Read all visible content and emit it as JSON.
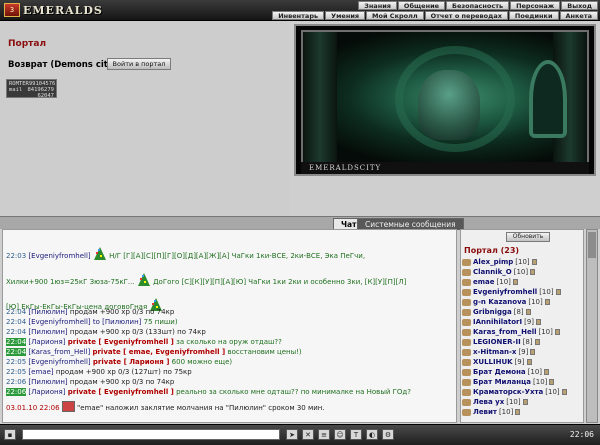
{
  "app": {
    "logo_mark": "3",
    "logo_name": "EMERALDS"
  },
  "menu": {
    "row1": [
      "Знания",
      "Общение",
      "Безопасность",
      "Персонаж",
      "Выход"
    ],
    "row2": [
      "Инвентарь",
      "Умения",
      "Мой Скролл",
      "Отчет о переводах",
      "Поединки",
      "Анкета"
    ]
  },
  "left": {
    "portal_title": "Портал",
    "return_label": "Возврат (Demons city)",
    "enter_button": "Войти в портал",
    "counter": {
      "r1a": "ROMTER",
      "r1b": "99104576",
      "r2a": "mail",
      "r2b": "84196279",
      "r3b": "62047"
    }
  },
  "scene": {
    "caption": "EMERALDSCITY"
  },
  "tabs": [
    {
      "label": "Чат"
    },
    {
      "label": "Системные сообщения"
    }
  ],
  "chat": {
    "lines": [
      {
        "time": "22:03",
        "nick": "[Evgeniyfromhell]",
        "text": "Н/Г [Г][А][С][П][Г][О][Д][А][Ж][А] ЧаГки 1ки-ВСЕ, 2ки-ВСЕ, Эка ПеГчи,"
      },
      {
        "time": "",
        "nick": "",
        "text": "Хилки+900 1юз=25кГ Зюза-75кГ...",
        "text2": "ДоГого [С][К][У][П][А][Ю] ЧаГки 1ки 2ки и особенно 3ки, [К][У][П][Л]"
      },
      {
        "time": "",
        "nick": "",
        "text": "[Ю] ЕкГы-ЕкГы-ЕкГы-цена договоГная"
      },
      {
        "time": "22:04",
        "nick": "[Пилюлин]",
        "text": "продам +900 хр 0/3 по 74кр"
      },
      {
        "time": "22:04",
        "nick": "[Evgeniyfromhell]",
        "to": "to [Пилюлин]",
        "text": "75 пиши)"
      },
      {
        "time": "22:04",
        "nick": "[Пилюлин]",
        "text": "продам +900 хр 0/3 (133шт) по 74кр"
      },
      {
        "time": "22:04",
        "nick": "[Ларионя]",
        "priv": "private [ Evgeniyfromhell ]",
        "text": "за сколько на оруж отдаш??"
      },
      {
        "time": "22:04",
        "nick": "[Karas_from_Hell]",
        "priv": "private [ emae, Evgeniyfromhell ]",
        "text": "восстановим цены!)"
      },
      {
        "time": "22:05",
        "nick": "[Evgeniyfromhell]",
        "priv": "private [ Ларионя ]",
        "text": "600 можно еще)"
      },
      {
        "time": "22:05",
        "nick": "[emae]",
        "text": "продам +900 хр 0/3 (127шт) по 75кр"
      },
      {
        "time": "22:06",
        "nick": "[Пилюлин]",
        "text": "продам +900 хр 0/3 по 74кр"
      },
      {
        "time": "22:06",
        "nick": "[Ларионя]",
        "priv": "private [ Evgeniyfromhell ]",
        "text": "реально за сколько мне одташ?? по минималке на Новый ГОд?"
      },
      {
        "time": "03.01.10 22:06",
        "nick": "",
        "text": "\"emae\" наложил заклятие молчания на \"Пилюлин\" сроком 30 мин."
      }
    ]
  },
  "userlist": {
    "refresh": "Обновить",
    "count": "Портал (23)",
    "users": [
      {
        "name": "Alex_pimp",
        "lvl": "[10]"
      },
      {
        "name": "Clannik_O",
        "lvl": "[10]"
      },
      {
        "name": "emae",
        "lvl": "[10]"
      },
      {
        "name": "Evgeniyfromhell",
        "lvl": "[10]"
      },
      {
        "name": "g-n Kazanova",
        "lvl": "[10]"
      },
      {
        "name": "Gribnigga",
        "lvl": "[8]"
      },
      {
        "name": "IAnnihilatorI",
        "lvl": "[9]"
      },
      {
        "name": "Karas_from_Hell",
        "lvl": "[10]"
      },
      {
        "name": "LEGIONER-II",
        "lvl": "[8]"
      },
      {
        "name": "x-Hitman-x",
        "lvl": "[9]"
      },
      {
        "name": "XULLIHUK",
        "lvl": "[9]"
      },
      {
        "name": "Брат Демона",
        "lvl": "[10]"
      },
      {
        "name": "Брат Миланца",
        "lvl": "[10]"
      },
      {
        "name": "Краматорск-Ухта",
        "lvl": "[10]"
      },
      {
        "name": "Лева ух",
        "lvl": "[10]"
      },
      {
        "name": "Левит",
        "lvl": "[10]"
      }
    ]
  },
  "bottom": {
    "time": "22:06"
  }
}
